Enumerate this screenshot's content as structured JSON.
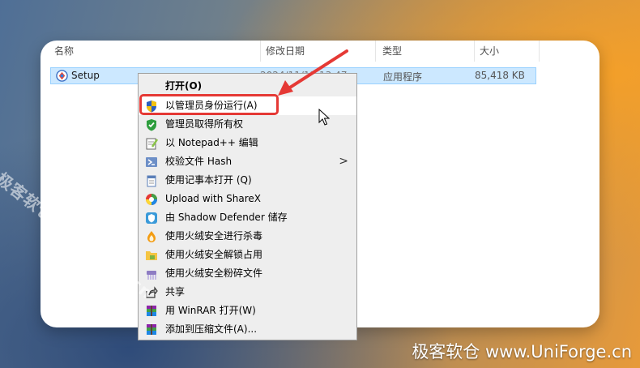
{
  "explorer": {
    "columns": {
      "name": "名称",
      "date": "修改日期",
      "type": "类型",
      "size": "大小"
    },
    "file": {
      "name": "Setup",
      "date": "2024/11/13 13:47",
      "type": "应用程序",
      "size": "85,418 KB",
      "icon": "setup-app-icon"
    }
  },
  "context_menu": {
    "items": [
      {
        "label": "打开(O)",
        "icon": "",
        "bold": true
      },
      {
        "label": "以管理员身份运行(A)",
        "icon": "uac-shield-icon",
        "hover": true
      },
      {
        "label": "管理员取得所有权",
        "icon": "green-shield-icon"
      },
      {
        "label": "以 Notepad++ 编辑",
        "icon": "notepadpp-icon"
      },
      {
        "label": "校验文件 Hash",
        "icon": "powershell-icon",
        "submenu": ">"
      },
      {
        "label": "使用记事本打开 (Q)",
        "icon": "notepad-icon"
      },
      {
        "label": "Upload with ShareX",
        "icon": "sharex-icon"
      },
      {
        "label": "由 Shadow Defender 储存",
        "icon": "shadow-defender-icon"
      },
      {
        "label": "使用火绒安全进行杀毒",
        "icon": "huorong-icon"
      },
      {
        "label": "使用火绒安全解锁占用",
        "icon": "folder-unlock-icon"
      },
      {
        "label": "使用火绒安全粉碎文件",
        "icon": "shredder-icon"
      },
      {
        "label": "共享",
        "icon": "share-icon"
      },
      {
        "label": "用 WinRAR 打开(W)",
        "icon": "winrar-icon"
      },
      {
        "label": "添加到压缩文件(A)...",
        "icon": "winrar-icon"
      }
    ]
  },
  "watermark": {
    "diagonal": "极客软仓 UniForge.cn",
    "bottom": "极客软仓 www.UniForge.cn"
  },
  "colors": {
    "highlight": "#e53935",
    "selection": "#cce8ff",
    "menu_bg": "#eeeeee"
  }
}
